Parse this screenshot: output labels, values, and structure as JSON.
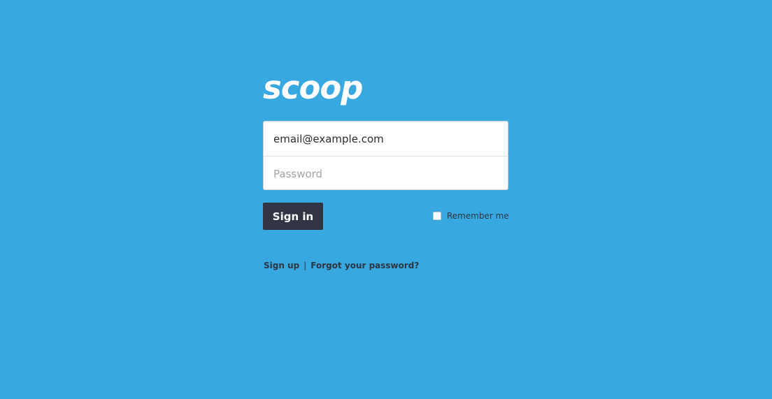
{
  "brand": {
    "logo_text": "scoop"
  },
  "form": {
    "email_value": "email@example.com",
    "password_placeholder": "Password",
    "signin_label": "Sign in",
    "remember_label": "Remember me",
    "remember_checked": false
  },
  "links": {
    "signup_label": "Sign up",
    "separator": "|",
    "forgot_label": "Forgot your password?"
  },
  "colors": {
    "background": "#38a8e0",
    "button": "#313543",
    "text_dark": "#2e3440"
  }
}
